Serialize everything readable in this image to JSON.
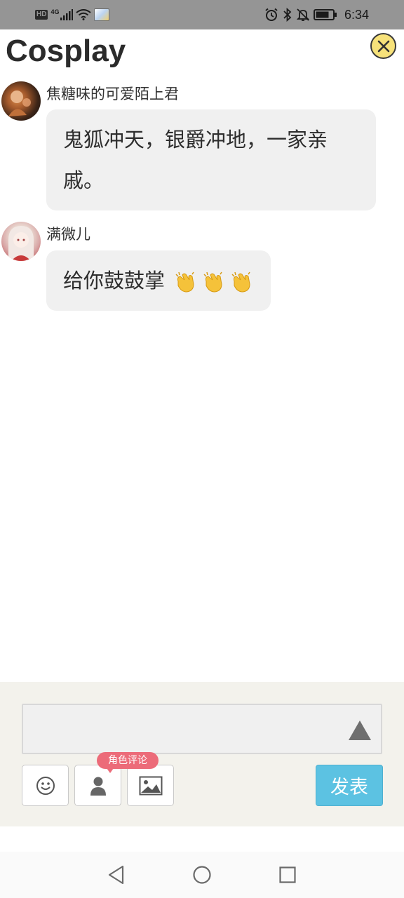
{
  "status_bar": {
    "hd": "HD",
    "network": "4G",
    "time": "6:34"
  },
  "header": {
    "title": "Cosplay"
  },
  "comments": [
    {
      "username": "焦糖味的可爱陌上君",
      "line1": "鬼狐冲天，银爵冲地，一家亲",
      "line2": "戚。",
      "avatar": "avatar-1"
    },
    {
      "username": "满微儿",
      "text": "给你鼓鼓掌",
      "emojis": [
        "clapping-hands-icon",
        "clapping-hands-icon",
        "clapping-hands-icon"
      ],
      "avatar": "avatar-2"
    }
  ],
  "composer": {
    "input_value": "",
    "role_badge": "角色评论",
    "post_label": "发表",
    "tools": [
      "smiley-icon",
      "person-icon",
      "image-icon"
    ]
  },
  "colors": {
    "status_bar": "#959595",
    "close_button": "#f7e27a",
    "bubble": "#f0f0f0",
    "composer_bg": "#f3f2ec",
    "role_badge": "#ec6b79",
    "post_button": "#5cc2e2"
  }
}
